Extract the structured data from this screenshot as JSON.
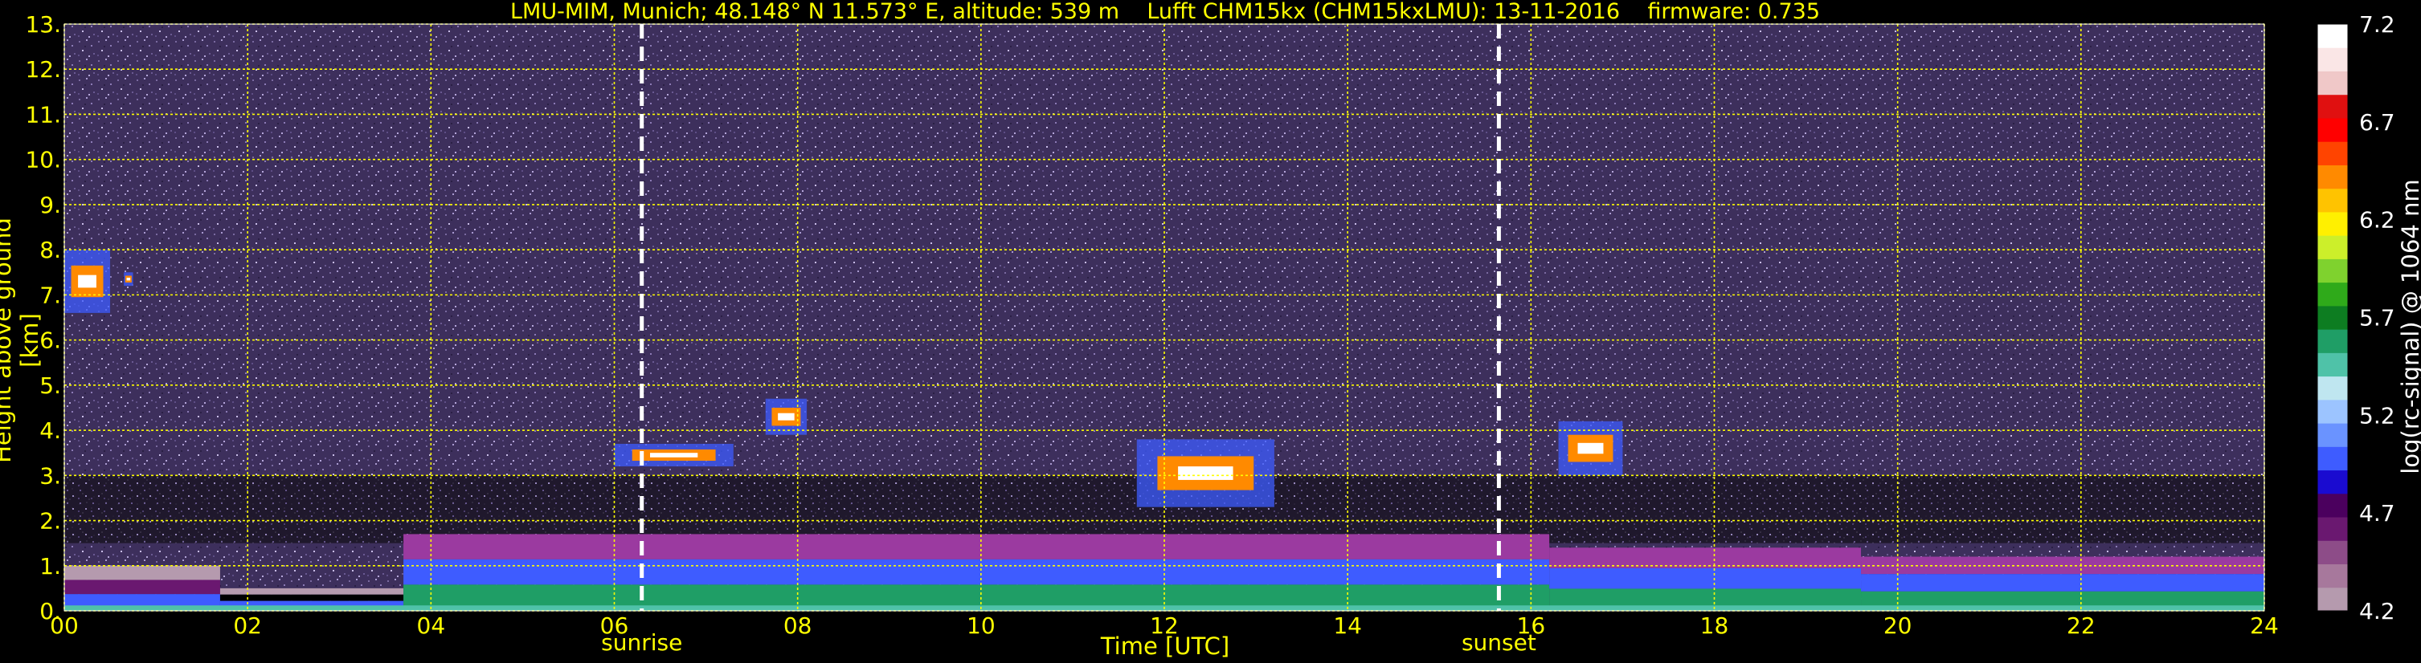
{
  "title": {
    "station": "LMU-MIM, Munich; 48.148° N 11.573° E, altitude: 539 m",
    "instrument": "Lufft CHM15kx (CHM15kxLMU): 13-11-2016",
    "firmware": "firmware: 0.735"
  },
  "colors": {
    "background": "#000000",
    "text": "#ffff00",
    "grid": "#ffff00",
    "marker": "#ffffff",
    "noise": "#4a3a6a"
  },
  "chart_data": {
    "type": "heatmap",
    "xlabel": "Time [UTC]",
    "ylabel": "Height above ground [km]",
    "xlim": [
      0,
      24
    ],
    "ylim": [
      0,
      13
    ],
    "x_ticks": [
      "00",
      "02",
      "04",
      "06",
      "08",
      "10",
      "12",
      "14",
      "16",
      "18",
      "20",
      "22",
      "24"
    ],
    "y_ticks": [
      "0.",
      "1.",
      "2.",
      "3.",
      "4.",
      "5.",
      "6.",
      "7.",
      "8.",
      "9.",
      "10.",
      "11.",
      "12.",
      "13."
    ],
    "grid": true,
    "colorbar": {
      "label": "log(rc-signal) @ 1064 nm",
      "range": [
        4.2,
        7.2
      ],
      "ticks": [
        "4.2",
        "4.7",
        "5.2",
        "5.7",
        "6.2",
        "6.7",
        "7.2"
      ],
      "colors": [
        "#b59aae",
        "#a7789c",
        "#8d4c88",
        "#6a1870",
        "#4b005e",
        "#1a0bd0",
        "#3e5cff",
        "#6a93ff",
        "#9cc4ff",
        "#bfe6f0",
        "#4fc2a8",
        "#1f9e66",
        "#0d7d21",
        "#2faa1a",
        "#7fd22e",
        "#ccef2a",
        "#fff000",
        "#ffc300",
        "#ff8a00",
        "#ff4400",
        "#ff0000",
        "#e01010",
        "#f0c8c8",
        "#fae6e6",
        "#ffffff"
      ]
    },
    "markers": [
      {
        "label": "sunrise",
        "time_h": 6.3
      },
      {
        "label": "sunset",
        "time_h": 15.65
      }
    ],
    "layers": [
      {
        "kind": "residual_layer",
        "t_start": 0.0,
        "t_end": 1.7,
        "h_bottom": 0.1,
        "h_top": 1.0
      },
      {
        "kind": "boundary_layer",
        "t_start": 1.7,
        "t_end": 3.7,
        "h_bottom": 0.1,
        "h_top": 0.5
      },
      {
        "kind": "aerosol_layer",
        "t_start": 3.7,
        "t_end": 16.2,
        "h_bottom": 0.1,
        "h_top": 1.7
      },
      {
        "kind": "aerosol_layer",
        "t_start": 16.2,
        "t_end": 19.6,
        "h_bottom": 0.1,
        "h_top": 1.4
      },
      {
        "kind": "aerosol_layer",
        "t_start": 19.6,
        "t_end": 24.0,
        "h_bottom": 0.1,
        "h_top": 1.2
      }
    ],
    "clouds": [
      {
        "t_start": 0.0,
        "t_end": 0.5,
        "h_bottom": 6.6,
        "h_top": 8.0
      },
      {
        "t_start": 0.65,
        "t_end": 0.75,
        "h_bottom": 7.2,
        "h_top": 7.5
      },
      {
        "t_start": 6.0,
        "t_end": 7.3,
        "h_bottom": 3.2,
        "h_top": 3.7
      },
      {
        "t_start": 7.65,
        "t_end": 8.1,
        "h_bottom": 3.9,
        "h_top": 4.7
      },
      {
        "t_start": 11.7,
        "t_end": 13.2,
        "h_bottom": 2.3,
        "h_top": 3.8
      },
      {
        "t_start": 16.3,
        "t_end": 17.0,
        "h_bottom": 3.0,
        "h_top": 4.2
      }
    ]
  }
}
